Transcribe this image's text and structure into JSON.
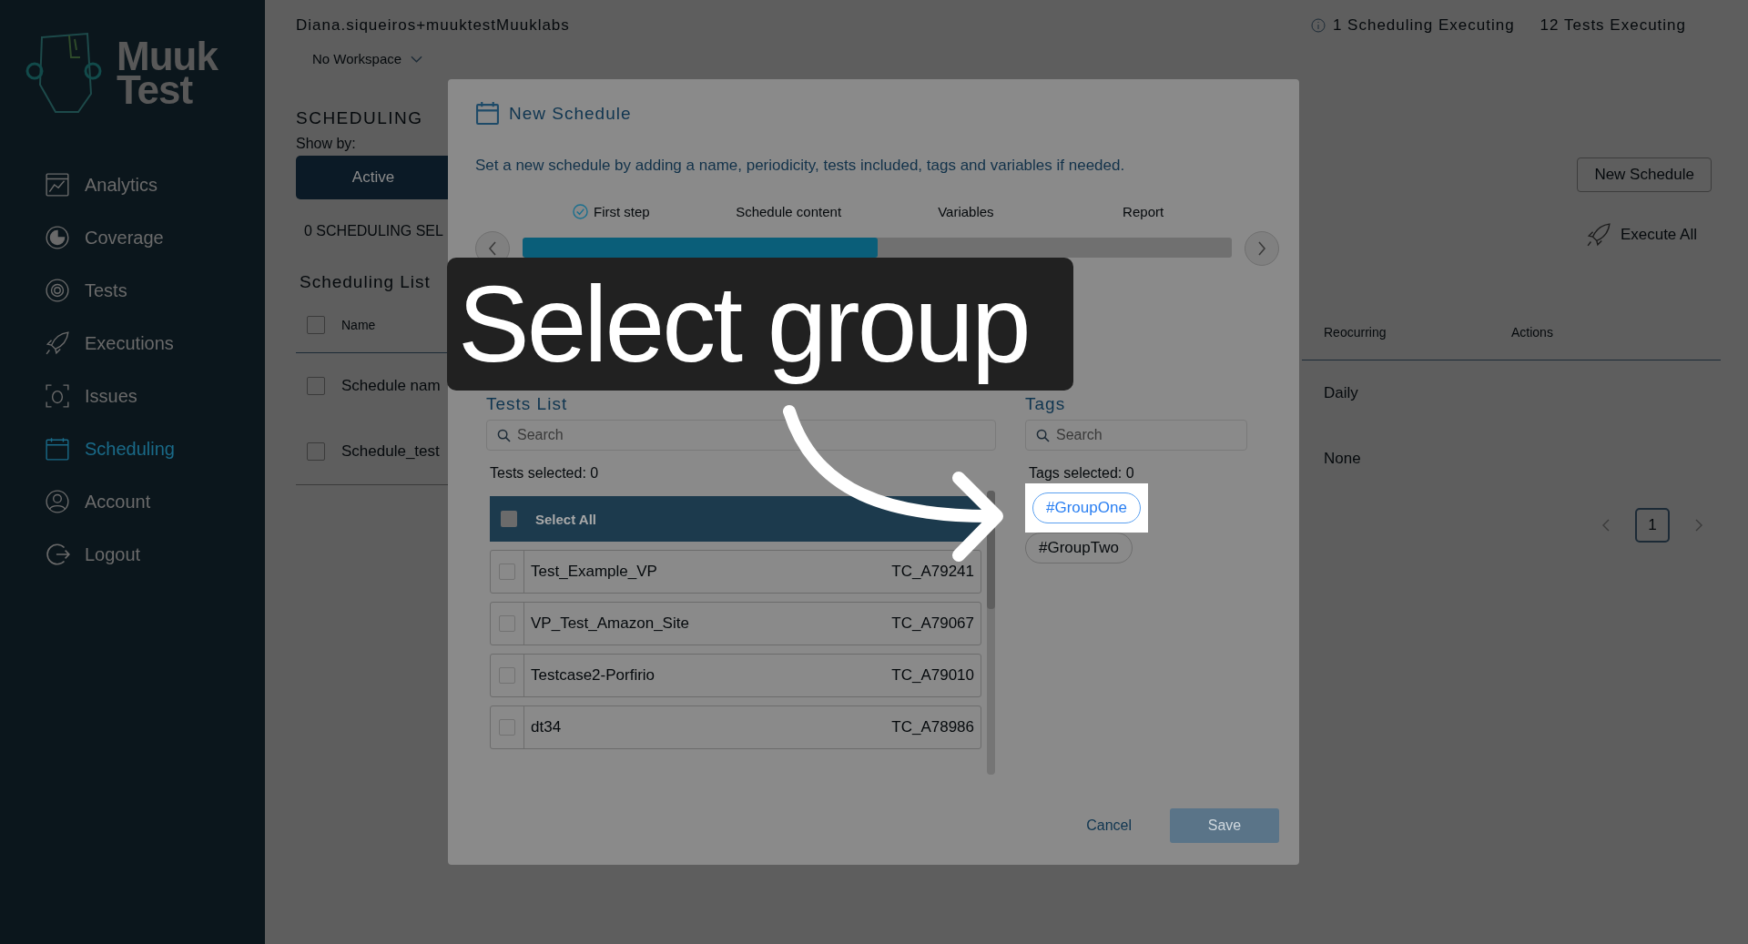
{
  "logo": {
    "line_1": "Muuk",
    "line_2": "Test"
  },
  "sidebar": {
    "items": [
      {
        "label": "Analytics",
        "selected": false
      },
      {
        "label": "Coverage",
        "selected": false
      },
      {
        "label": "Tests",
        "selected": false
      },
      {
        "label": "Executions",
        "selected": false
      },
      {
        "label": "Issues",
        "selected": false
      },
      {
        "label": "Scheduling",
        "selected": true
      },
      {
        "label": "Account",
        "selected": false
      },
      {
        "label": "Logout",
        "selected": false
      }
    ]
  },
  "header": {
    "user": "Diana.siqueiros+muuktestMuuklabs",
    "workspace": "No Workspace",
    "statuses": [
      {
        "text": "1 Scheduling Executing",
        "kind": "info"
      },
      {
        "text": "12 Tests Executing",
        "kind": "plain"
      }
    ]
  },
  "page": {
    "title": "SCHEDULING",
    "show_by_label": "Show by:",
    "filter_button": "Active",
    "selection_count": "0 SCHEDULING SEL",
    "new_button": "New Schedule",
    "execute_button": "Execute All",
    "list_title": "Scheduling List",
    "table": {
      "columns": [
        "Name",
        "Reocurring",
        "Actions"
      ],
      "header_checked": false,
      "rows": [
        {
          "name": "Schedule nam",
          "recurring": "Daily",
          "checked": false
        },
        {
          "name": "Schedule_test",
          "recurring": "None",
          "checked": false
        }
      ]
    },
    "pagination": [
      {
        "label": "1",
        "selected": true
      }
    ]
  },
  "modal": {
    "title": "New Schedule",
    "description": "Set a new schedule by adding a name, periodicity, tests included, tags and variables if needed.",
    "steps": [
      {
        "label": "First step",
        "done": true
      },
      {
        "label": "Schedule content",
        "done": false
      },
      {
        "label": "Variables",
        "done": false
      },
      {
        "label": "Report",
        "done": false
      }
    ],
    "progress": {
      "level": 0.5
    },
    "tests": {
      "title": "Tests List",
      "search": {
        "placeholder": "Search"
      },
      "selected_count": "Tests selected: 0",
      "select_all": {
        "label": "Select All",
        "checked": false
      },
      "items": [
        {
          "name": "Test_Example_VP",
          "code": "TC_A79241",
          "checked": false
        },
        {
          "name": "VP_Test_Amazon_Site",
          "code": "TC_A79067",
          "checked": false
        },
        {
          "name": "Testcase2-Porfirio",
          "code": "TC_A79010",
          "checked": false
        },
        {
          "name": "dt34",
          "code": "TC_A78986",
          "checked": false
        }
      ]
    },
    "tags": {
      "title": "Tags",
      "search": {
        "placeholder": "Search"
      },
      "selected_count": "Tags selected: 0",
      "items": [
        {
          "label": "#GroupOne",
          "highlighted": true
        },
        {
          "label": "#GroupTwo",
          "highlighted": false
        }
      ]
    },
    "cancel": "Cancel",
    "save": {
      "label": "Save",
      "disabled": true
    }
  },
  "caption": "Select group"
}
